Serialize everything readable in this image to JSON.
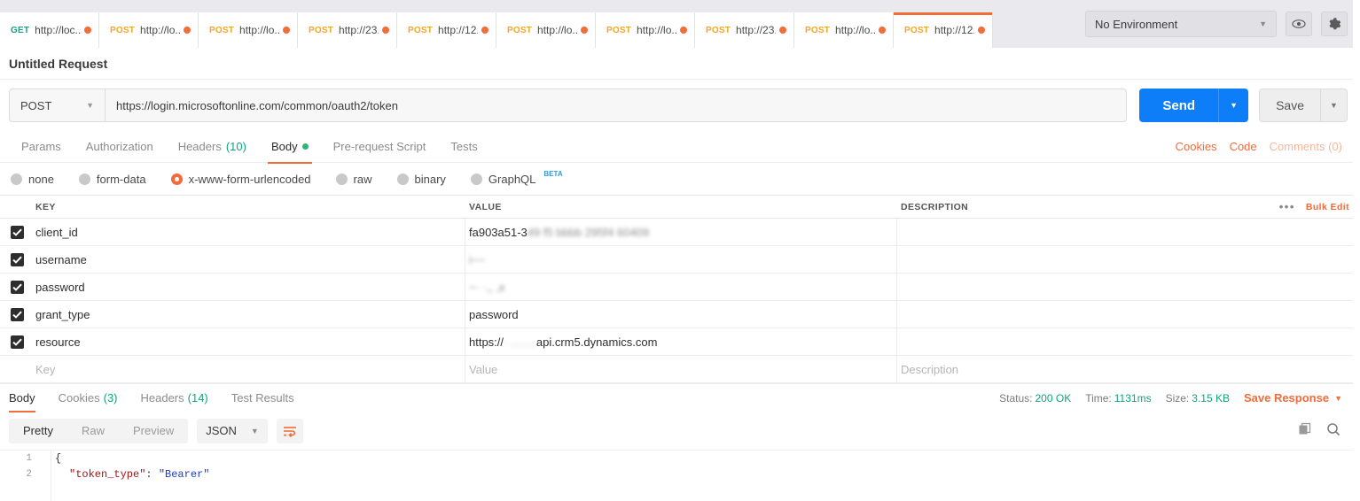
{
  "tabs": [
    {
      "method": "GET",
      "url": "http://loc...",
      "unsaved": true,
      "active": false
    },
    {
      "method": "POST",
      "url": "http://lo...",
      "unsaved": true,
      "active": false
    },
    {
      "method": "POST",
      "url": "http://lo...",
      "unsaved": true,
      "active": false
    },
    {
      "method": "POST",
      "url": "http://23...",
      "unsaved": true,
      "active": false
    },
    {
      "method": "POST",
      "url": "http://12...",
      "unsaved": true,
      "active": false
    },
    {
      "method": "POST",
      "url": "http://lo...",
      "unsaved": true,
      "active": false
    },
    {
      "method": "POST",
      "url": "http://lo...",
      "unsaved": true,
      "active": false
    },
    {
      "method": "POST",
      "url": "http://23...",
      "unsaved": true,
      "active": false
    },
    {
      "method": "POST",
      "url": "http://lo...",
      "unsaved": true,
      "active": false
    },
    {
      "method": "POST",
      "url": "http://12...",
      "unsaved": true,
      "active": true
    }
  ],
  "tab_actions": {
    "new_tab": "+",
    "more": "•••"
  },
  "environment": {
    "selected": "No Environment",
    "caret": "▼",
    "eye_icon": "eye-icon",
    "gear_icon": "gear-icon"
  },
  "request": {
    "name": "Untitled Request",
    "method": "POST",
    "method_caret": "▼",
    "url": "https://login.microsoftonline.com/common/oauth2/token",
    "send_label": "Send",
    "send_caret": "▼",
    "save_label": "Save",
    "save_caret": "▼"
  },
  "request_tabs": [
    {
      "label": "Params",
      "count": "",
      "active": false,
      "dot": false
    },
    {
      "label": "Authorization",
      "count": "",
      "active": false,
      "dot": false
    },
    {
      "label": "Headers",
      "count": "(10)",
      "active": false,
      "dot": false
    },
    {
      "label": "Body",
      "count": "",
      "active": true,
      "dot": true
    },
    {
      "label": "Pre-request Script",
      "count": "",
      "active": false,
      "dot": false
    },
    {
      "label": "Tests",
      "count": "",
      "active": false,
      "dot": false
    }
  ],
  "request_tabs_right": {
    "cookies": "Cookies",
    "code": "Code",
    "comments": "Comments (0)"
  },
  "body_types": [
    {
      "label": "none",
      "checked": false,
      "beta": ""
    },
    {
      "label": "form-data",
      "checked": false,
      "beta": ""
    },
    {
      "label": "x-www-form-urlencoded",
      "checked": true,
      "beta": ""
    },
    {
      "label": "raw",
      "checked": false,
      "beta": ""
    },
    {
      "label": "binary",
      "checked": false,
      "beta": ""
    },
    {
      "label": "GraphQL",
      "checked": false,
      "beta": "BETA"
    }
  ],
  "kv_table": {
    "headers": {
      "key": "KEY",
      "value": "VALUE",
      "description": "DESCRIPTION"
    },
    "bulk_edit": "Bulk Edit",
    "more_dots": "•••",
    "rows": [
      {
        "checked": true,
        "key": "client_id",
        "value": "fa903a51-3",
        "value_redacted": "49 f5 bbbb  295f4 60409",
        "description": ""
      },
      {
        "checked": true,
        "key": "username",
        "value": "",
        "value_redacted": "i~~",
        "description": ""
      },
      {
        "checked": true,
        "key": "password",
        "value": "",
        "value_redacted": "~· ·,, ,ιι",
        "description": ""
      },
      {
        "checked": true,
        "key": "grant_type",
        "value": "password",
        "value_redacted": "",
        "description": ""
      },
      {
        "checked": true,
        "key": "resource",
        "value_prefix": "https://",
        "value_redacted": " ·  ........",
        "value_suffix": "api.crm5.dynamics.com",
        "description": ""
      }
    ],
    "new_row": {
      "key": "Key",
      "value": "Value",
      "description": "Description"
    }
  },
  "response_tabs": [
    {
      "label": "Body",
      "count": "",
      "active": true
    },
    {
      "label": "Cookies",
      "count": "(3)",
      "active": false
    },
    {
      "label": "Headers",
      "count": "(14)",
      "active": false
    },
    {
      "label": "Test Results",
      "count": "",
      "active": false
    }
  ],
  "response_meta": {
    "status_label": "Status:",
    "status_value": "200 OK",
    "time_label": "Time:",
    "time_value": "1131ms",
    "size_label": "Size:",
    "size_value": "3.15 KB",
    "save_response": "Save Response",
    "save_response_caret": "▼"
  },
  "view_bar": {
    "modes": [
      {
        "label": "Pretty",
        "active": true
      },
      {
        "label": "Raw",
        "active": false
      },
      {
        "label": "Preview",
        "active": false
      }
    ],
    "format": "JSON",
    "format_caret": "▼",
    "wrap_icon": "wrap-lines-icon",
    "copy_icon": "copy-icon",
    "search_icon": "search-icon"
  },
  "response_body": {
    "lines": [
      {
        "number": "1",
        "text": "{"
      },
      {
        "number": "2",
        "key": "\"token_type\"",
        "sep": ": ",
        "value": "\"Bearer\""
      }
    ]
  },
  "colors": {
    "accent": "#f26b3a",
    "send_blue": "#0d7ef7",
    "green": "#11a47c",
    "get_green": "#16a085",
    "post_orange": "#f5a623"
  }
}
